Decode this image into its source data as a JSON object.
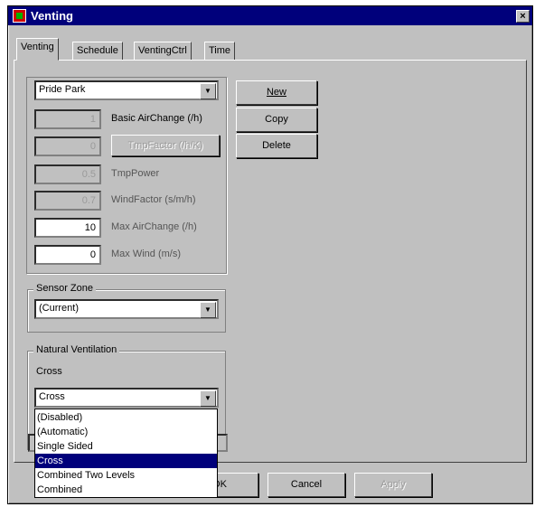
{
  "window": {
    "title": "Venting",
    "close_label": "×"
  },
  "tabs": [
    {
      "label": "Venting",
      "active": true
    },
    {
      "label": "Schedule",
      "active": false
    },
    {
      "label": "VentingCtrl",
      "active": false
    },
    {
      "label": "Time",
      "active": false
    }
  ],
  "profile_select": {
    "value": "Pride Park"
  },
  "fields": [
    {
      "value": "1",
      "label": "Basic AirChange (/h)",
      "editable": false
    },
    {
      "value": "0",
      "label": "TmpFactor (/h/K)",
      "editable": false
    },
    {
      "value": "0.5",
      "label": "TmpPower",
      "editable": false
    },
    {
      "value": "0.7",
      "label": "WindFactor (s/m/h)",
      "editable": false
    },
    {
      "value": "10",
      "label": "Max AirChange (/h)",
      "editable": true
    },
    {
      "value": "0",
      "label": "Max Wind (m/s)",
      "editable": true
    }
  ],
  "side_buttons": {
    "new": "New",
    "copy": "Copy",
    "delete": "Delete"
  },
  "sensor_zone": {
    "legend": "Sensor Zone",
    "value": "(Current)"
  },
  "natural_ventilation": {
    "legend": "Natural Ventilation",
    "sub_label": "Cross",
    "value": "Cross",
    "options": [
      "(Disabled)",
      "(Automatic)",
      "Single Sided",
      "Cross",
      "Combined Two Levels",
      "Combined"
    ],
    "selected_index": 3
  },
  "footer": {
    "ok": "OK",
    "cancel": "Cancel",
    "apply": "Apply"
  },
  "colors": {
    "title_bar": "#00007b",
    "face": "#c0c0c0",
    "selection": "#00007b"
  }
}
